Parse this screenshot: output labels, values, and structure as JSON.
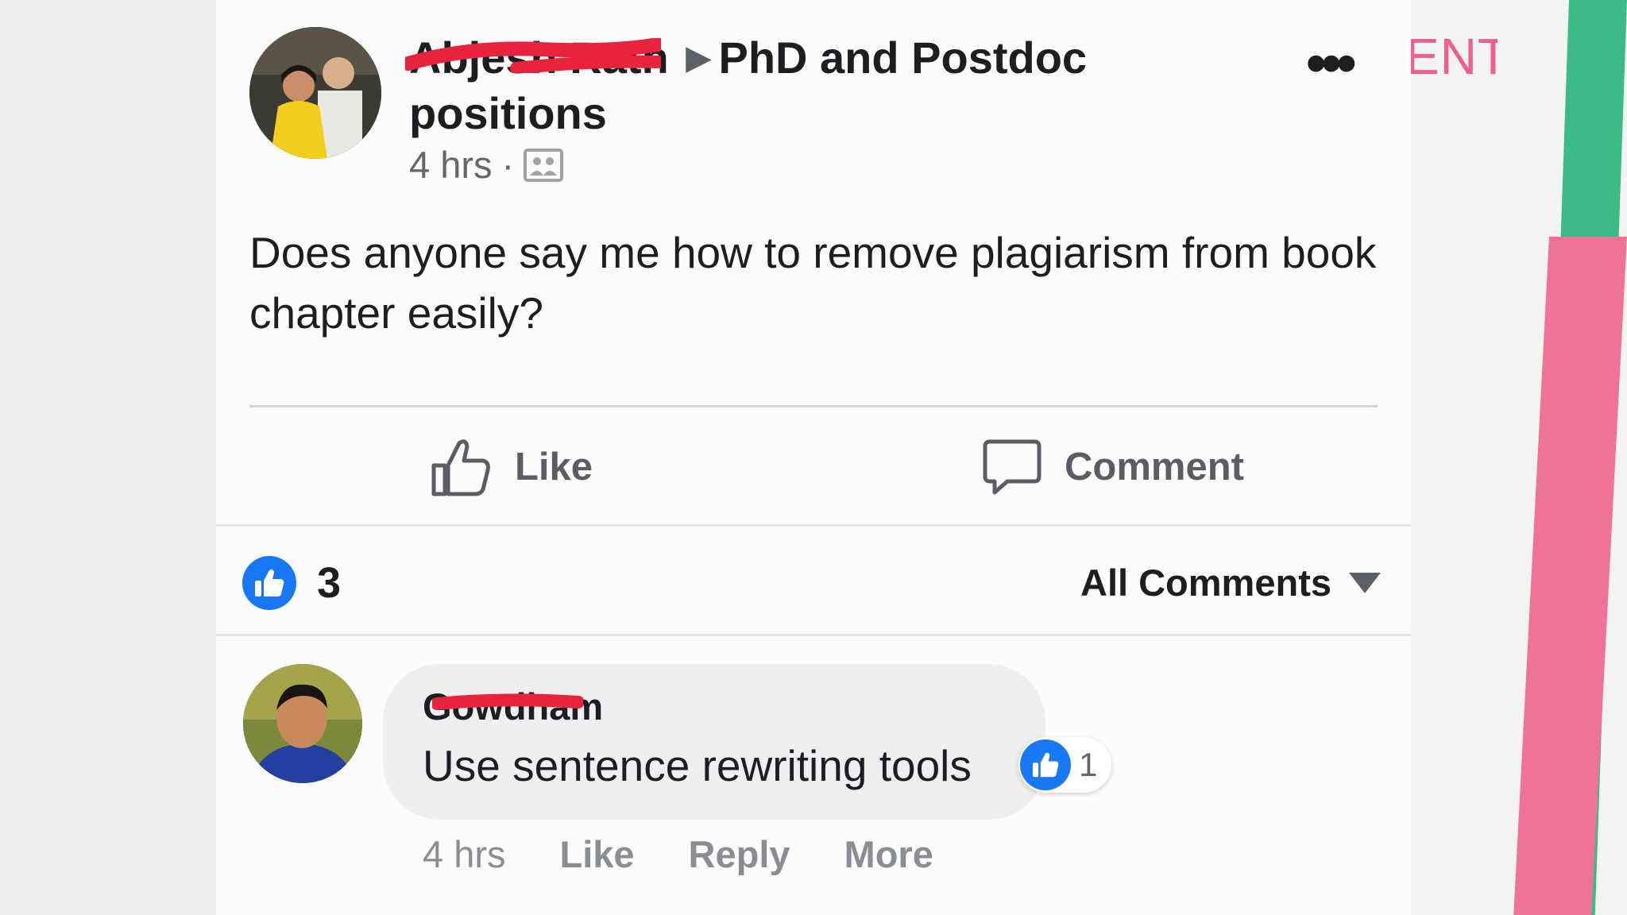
{
  "decor": {
    "partial_text": "ENT"
  },
  "post": {
    "author": "Abjesh Rath",
    "group": "PhD and Postdoc positions",
    "time": "4 hrs",
    "dot": "·",
    "more": "•••",
    "text": "Does anyone say me how to remove plagiarism from book chapter easily?",
    "actions": {
      "like": "Like",
      "comment": "Comment"
    },
    "reaction_count": "3",
    "comments_filter": "All Comments"
  },
  "comment": {
    "author": "Gowdham",
    "text": "Use sentence rewriting tools",
    "reaction_count": "1",
    "time": "4 hrs",
    "actions": {
      "like": "Like",
      "reply": "Reply",
      "more": "More"
    }
  },
  "colors": {
    "facebook_blue": "#1877f2",
    "redaction_red": "#e8243c",
    "accent_green": "#3dba8a",
    "accent_pink": "#ef7399"
  }
}
